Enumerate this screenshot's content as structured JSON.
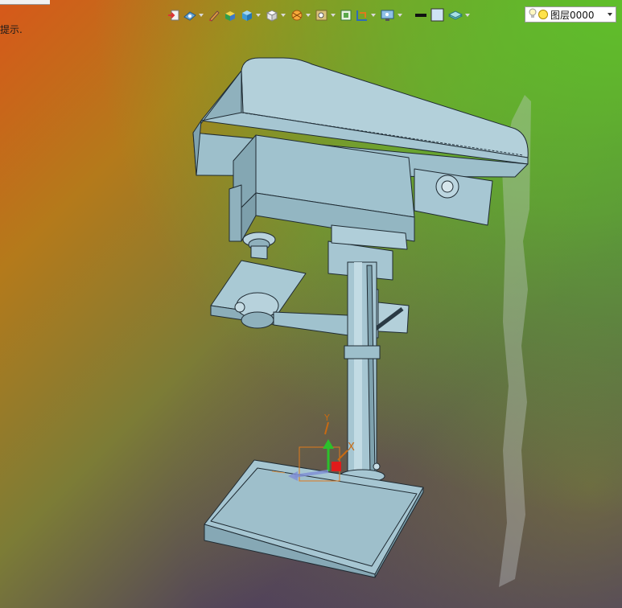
{
  "viewport": {
    "hint_text": "提示.",
    "layer_selector": {
      "value": "图层0000"
    },
    "axis_labels": {
      "x": "X",
      "y": "Y"
    }
  },
  "toolbar": {
    "icons": [
      "exit-sketch-icon",
      "view-orient-icon",
      "pencil-icon",
      "shaded-cube-icon",
      "blue-cube-icon",
      "white-cube-icon",
      "render-icon",
      "zoom-icon",
      "fit-view-icon",
      "section-view-icon",
      "display-settings-icon",
      "line-weight-icon",
      "color-swatch-icon",
      "layer-icon"
    ]
  },
  "colors": {
    "part_fill": "#a6c6d2",
    "part_light": "#c2dbe4",
    "part_dark": "#86a8b5",
    "outline": "#1f2b33"
  }
}
